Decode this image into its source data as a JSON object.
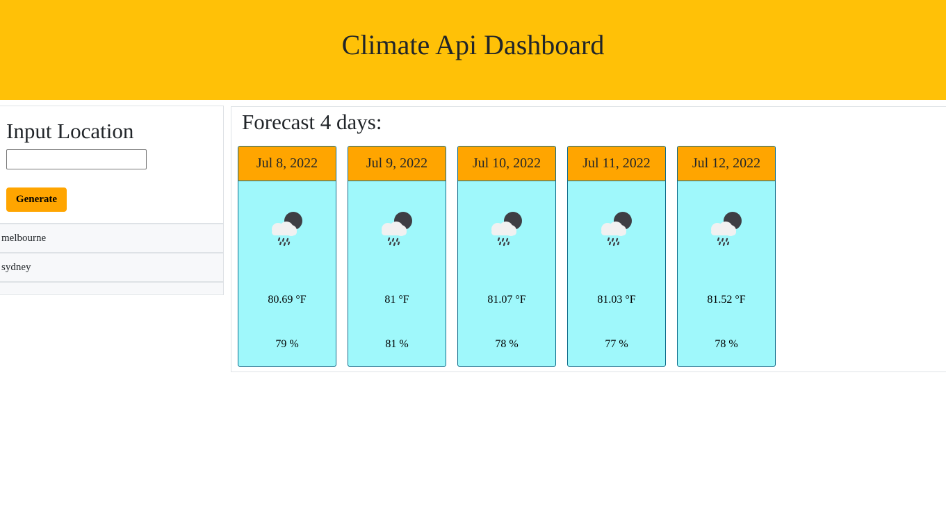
{
  "header": {
    "title": "Climate Api Dashboard"
  },
  "sidebar": {
    "heading": "Input Location",
    "input": {
      "value": "",
      "placeholder": ""
    },
    "button_label": "Generate",
    "history": [
      {
        "label": "melbourne"
      },
      {
        "label": "sydney"
      }
    ]
  },
  "main": {
    "heading": "Forecast 4 days:",
    "cards": [
      {
        "date": "Jul 8, 2022",
        "icon": "cloud-rain-moon-icon",
        "temp": "80.69 °F",
        "humidity": "79 %"
      },
      {
        "date": "Jul 9, 2022",
        "icon": "cloud-rain-moon-icon",
        "temp": "81 °F",
        "humidity": "81 %"
      },
      {
        "date": "Jul 10, 2022",
        "icon": "cloud-rain-moon-icon",
        "temp": "81.07 °F",
        "humidity": "78 %"
      },
      {
        "date": "Jul 11, 2022",
        "icon": "cloud-rain-moon-icon",
        "temp": "81.03 °F",
        "humidity": "77 %"
      },
      {
        "date": "Jul 12, 2022",
        "icon": "cloud-rain-moon-icon",
        "temp": "81.52 °F",
        "humidity": "78 %"
      }
    ]
  },
  "colors": {
    "header_bg": "#ffc107",
    "button_bg": "#ffa500",
    "card_header_bg": "#ffa500",
    "card_bg": "#9ff8fb",
    "card_border": "#0c6b8a"
  }
}
